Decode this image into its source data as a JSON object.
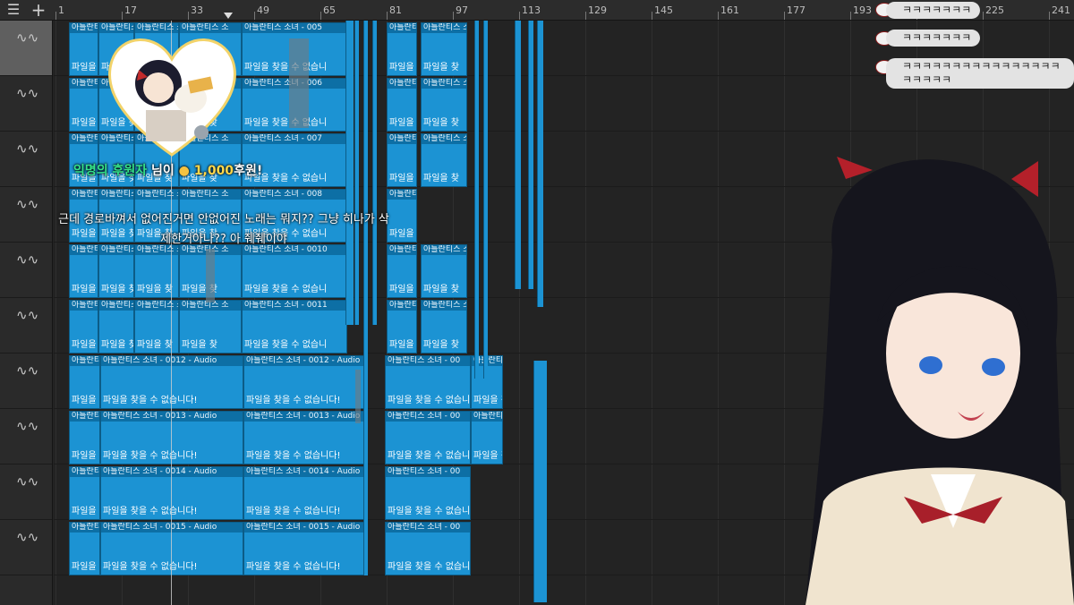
{
  "toolbar": {
    "menu_icon": "☰",
    "add_icon": "+"
  },
  "ruler": {
    "ticks": [
      "1",
      "17",
      "33",
      "49",
      "65",
      "81",
      "97",
      "113",
      "129",
      "145",
      "161",
      "177",
      "193",
      "209",
      "225",
      "241"
    ]
  },
  "tracks": {
    "count": 10,
    "icon": "waveform-icon"
  },
  "clips": {
    "name_prefix": "아틀란티스 소녀 - ",
    "short_name": "아틀란티스 소",
    "name_0011": "아틀란티스 소녀 - 0011",
    "name_0012": "아틀란티스 소녀 - 0012 - Audio",
    "name_0013": "아틀란티스 소녀 - 0013 - Audio",
    "name_0014": "아틀란티스 소녀 - 0014 - Audio",
    "name_0015": "아틀란티스 소녀 - 0015 - Audio",
    "missing_short": "파일을 찾을 수 없습니다!",
    "missing_trunc": "파일을 찾을 수 없습니",
    "missing_tiny": "파일을 찾",
    "color": "#1c93d3"
  },
  "donation": {
    "donor": "익명의 후원자",
    "mid": " 님이 ",
    "coin_icon": "coin-icon",
    "amount": "1,000",
    "suffix": "후원!",
    "message": "근데 경로바껴서 없어진거면 안없어진 노래는 뭐지?? 그냥 히나가 삭제한거아나?? 아 줴줴이야"
  },
  "chat": {
    "messages": [
      "ㅋㅋㅋㅋㅋㅋㅋ",
      "ㅋㅋㅋㅋㅋㅋㅋ",
      "ㅋㅋㅋㅋㅋㅋㅋㅋㅋㅋㅋㅋㅋㅋㅋㅋㅋㅋㅋㅋㅋ"
    ]
  },
  "colors": {
    "bg": "#232323",
    "clip": "#1c93d3",
    "clip_header": "#0d6fa5",
    "donor": "#35e38b",
    "amount": "#ffd84a"
  }
}
